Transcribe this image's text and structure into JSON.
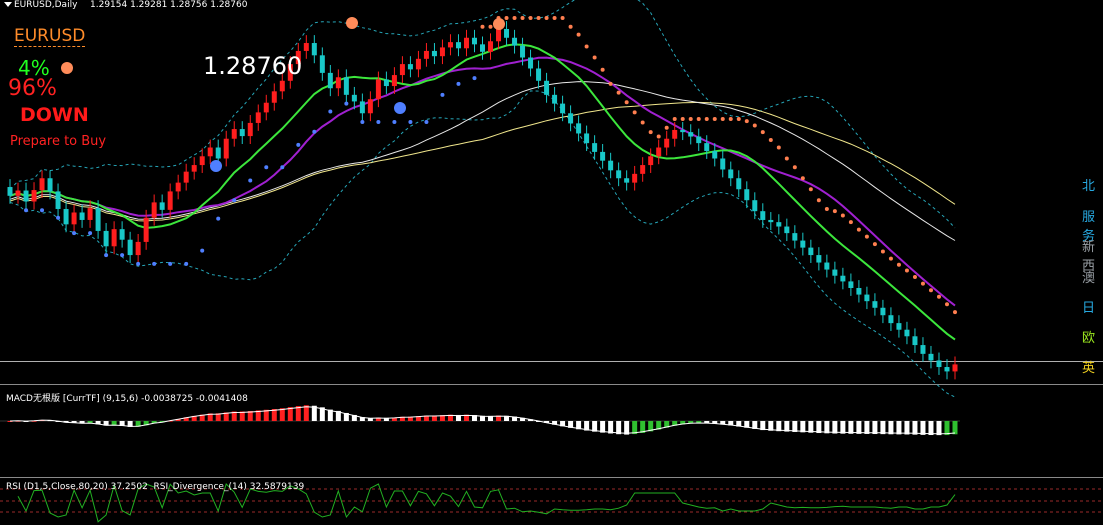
{
  "header": {
    "symbol_timeframe": "EURUSD,Daily",
    "ohlc": "1.29154 1.29281 1.28756 1.28760"
  },
  "overlay": {
    "symbol": "EURUSD",
    "price": "1.28760",
    "pct_up": "4%",
    "pct_down": "96%",
    "signal": "DOWN",
    "status": "Prepare to Buy"
  },
  "sidebar_labels": [
    {
      "text": "北",
      "color": "#27a9e1"
    },
    {
      "text": "服务",
      "color": "#27a9e1"
    },
    {
      "text": "新西",
      "color": "#9aa0a6"
    },
    {
      "text": "澳",
      "color": "#9aa0a6"
    },
    {
      "text": "日",
      "color": "#27a9e1"
    },
    {
      "text": "欧",
      "color": "#9be81f"
    },
    {
      "text": "英",
      "color": "#f0d020"
    }
  ],
  "macd_panel": {
    "label": "MACD无根版 [CurrTF] (9,15,6) -0.0038725 -0.0041408"
  },
  "rsi_panel": {
    "label": "RSI (D1,5,Close,80,20) 37.2502  RSI_Divergence_(14) 32.5879139"
  },
  "colors": {
    "bull_candle": "#ff1e1e",
    "bear_candle": "#19c8c8",
    "ma_purple": "#a020d0",
    "ma_green": "#3ce63c",
    "ma_yellow": "#f0e68c",
    "ma_white": "#e8e8e8",
    "bands": "#26a6b8",
    "stop_dots": "#ff7f50",
    "support_dots": "#4f7fff"
  },
  "chart_data": {
    "type": "line",
    "title": "EURUSD,Daily",
    "y_last": 1.2876,
    "close": [
      1.326,
      1.3272,
      1.3247,
      1.3273,
      1.33,
      1.327,
      1.323,
      1.3195,
      1.3222,
      1.3205,
      1.3232,
      1.318,
      1.3145,
      1.3184,
      1.316,
      1.3125,
      1.3155,
      1.321,
      1.3245,
      1.3228,
      1.327,
      1.329,
      1.3315,
      1.333,
      1.335,
      1.337,
      1.3345,
      1.339,
      1.3412,
      1.3396,
      1.3426,
      1.345,
      1.3472,
      1.3498,
      1.3522,
      1.356,
      1.359,
      1.3608,
      1.358,
      1.354,
      1.3505,
      1.353,
      1.349,
      1.3475,
      1.3448,
      1.348,
      1.3525,
      1.351,
      1.3535,
      1.356,
      1.3548,
      1.3572,
      1.359,
      1.3578,
      1.3598,
      1.361,
      1.3596,
      1.362,
      1.3605,
      1.3588,
      1.3612,
      1.364,
      1.362,
      1.3602,
      1.3575,
      1.355,
      1.3522,
      1.349,
      1.347,
      1.3448,
      1.3425,
      1.3402,
      1.338,
      1.336,
      1.334,
      1.3318,
      1.33,
      1.329,
      1.331,
      1.333,
      1.335,
      1.337,
      1.339,
      1.341,
      1.3405,
      1.3395,
      1.338,
      1.3362,
      1.3345,
      1.332,
      1.33,
      1.3275,
      1.325,
      1.3225,
      1.3205,
      1.32,
      1.319,
      1.3175,
      1.3158,
      1.3142,
      1.3125,
      1.3108,
      1.3092,
      1.3078,
      1.3065,
      1.305,
      1.3035,
      1.302,
      1.3005,
      1.2988,
      1.297,
      1.2955,
      1.294,
      1.292,
      1.29,
      1.2885,
      1.287,
      1.286,
      1.2876
    ]
  }
}
